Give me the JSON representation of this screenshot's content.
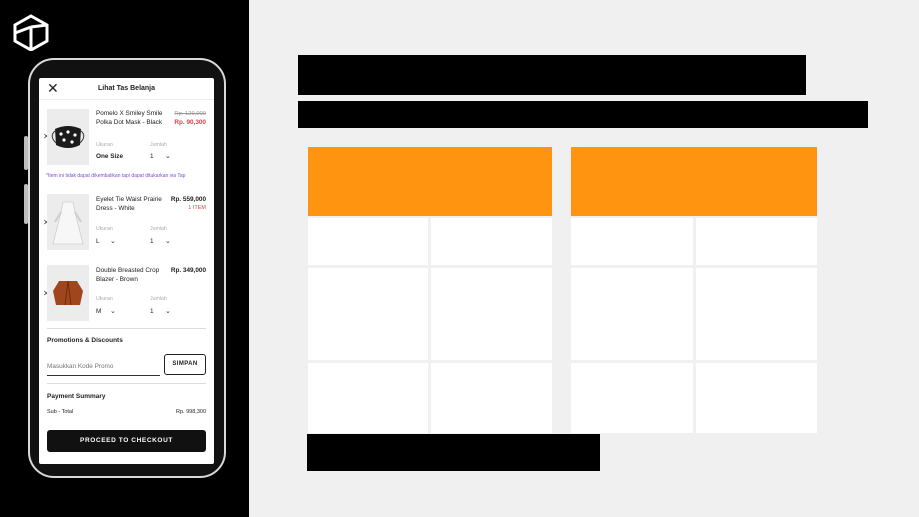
{
  "header": {
    "title": "Lihat Tas Belanja"
  },
  "cart": {
    "items": [
      {
        "name": "Pomelo X Smiley Smile Polka Dot Mask - Black",
        "original_price": "Rp. 129,000",
        "price": "Rp. 90,300",
        "size_label": "Ukuran",
        "size": "One Size",
        "qty_label": "Jumlah",
        "qty": "1"
      },
      {
        "name": "Eyelet Tie Waist Prairie Dress - White",
        "price": "Rp. 559,000",
        "stock": "1 ITEM",
        "size_label": "Ukuran",
        "size": "L",
        "qty_label": "Jumlah",
        "qty": "1"
      },
      {
        "name": "Double Breasted Crop Blazer - Brown",
        "price": "Rp. 349,000",
        "size_label": "Ukuran",
        "size": "M",
        "qty_label": "Jumlah",
        "qty": "1"
      }
    ],
    "note": "*Item ini tidak dapat dikembalikan tapi dapat ditukarkan via Tap"
  },
  "promo": {
    "title": "Promotions & Discounts",
    "placeholder": "Masukkan Kode Promo",
    "button_label": "SIMPAN"
  },
  "summary": {
    "title": "Payment Summary",
    "subtotal_label": "Sub - Total",
    "subtotal_value": "Rp. 998,300"
  },
  "checkout": {
    "label": "PROCEED TO CHECKOUT"
  },
  "colors": {
    "accent_orange": "#ff9410",
    "price_red": "#e53950",
    "note_purple": "#7b4fc9"
  },
  "icons": {
    "logo": "hexagon-cube-icon",
    "close": "close-icon",
    "remove": "remove-x-icon",
    "dropdown": "chevron-down-icon"
  }
}
